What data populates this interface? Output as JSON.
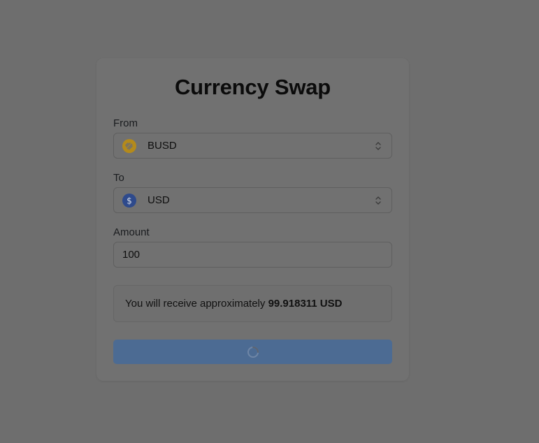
{
  "card": {
    "title": "Currency Swap"
  },
  "from": {
    "label": "From",
    "currency": "BUSD",
    "icon": "busd-coin-icon",
    "icon_color": "#b48a1b"
  },
  "to": {
    "label": "To",
    "currency": "USD",
    "icon": "usd-dollar-icon",
    "icon_color": "#2e4a8c"
  },
  "amount": {
    "label": "Amount",
    "value": "100"
  },
  "result": {
    "prefix": "You will receive approximately",
    "value": "99.918311 USD"
  },
  "swap_button": {
    "state": "loading",
    "icon": "loading-spinner-icon",
    "color": "#4c6b93"
  },
  "colors": {
    "overlay_background": "#6e6e6e",
    "card_background": "#717171"
  }
}
